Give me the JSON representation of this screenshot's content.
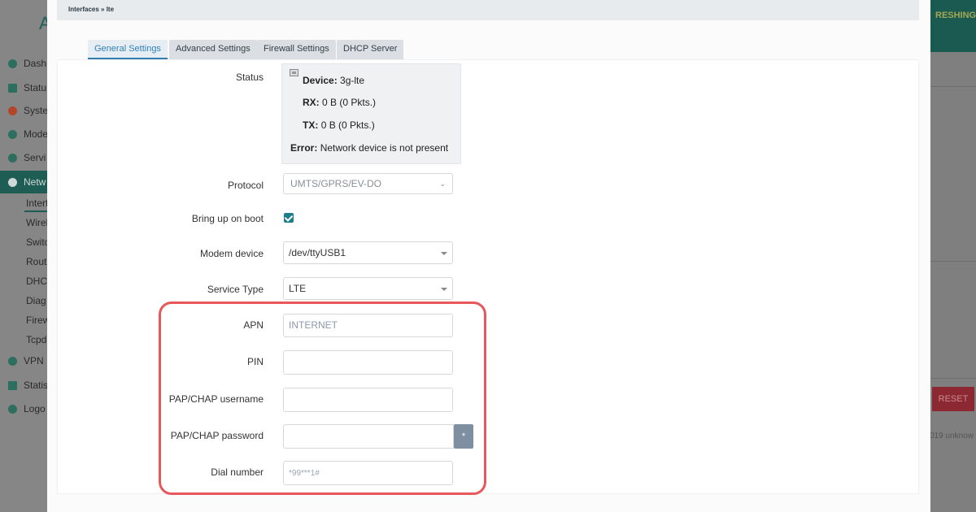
{
  "background": {
    "logo_letter": "A",
    "nav": [
      "Dash",
      "Statu",
      "Syste",
      "Mode",
      "Servi",
      "Netw",
      "VPN",
      "Statis",
      "Logo"
    ],
    "subnav": [
      "Interf",
      "Wirel",
      "Switc",
      "Rout",
      "DHC",
      "Diag",
      "Firew",
      "Tcpd"
    ],
    "refresh_label": "RESHING",
    "reset_label": "RESET",
    "copyright": "019 unknow"
  },
  "modal": {
    "breadcrumb": "Interfaces » lte",
    "tabs": [
      {
        "label": "General Settings",
        "active": true
      },
      {
        "label": "Advanced Settings",
        "active": false
      },
      {
        "label": "Firewall Settings",
        "active": false
      },
      {
        "label": "DHCP Server",
        "active": false
      }
    ]
  },
  "form": {
    "status_label": "Status",
    "status": {
      "device_key": "Device:",
      "device_val": "3g-lte",
      "rx_key": "RX:",
      "rx_val": "0 B (0 Pkts.)",
      "tx_key": "TX:",
      "tx_val": "0 B (0 Pkts.)",
      "error_key": "Error:",
      "error_val": "Network device is not present"
    },
    "protocol_label": "Protocol",
    "protocol_value": "UMTS/GPRS/EV-DO",
    "boot_label": "Bring up on boot",
    "boot_checked": true,
    "modem_label": "Modem device",
    "modem_value": "/dev/ttyUSB1",
    "service_label": "Service Type",
    "service_value": "LTE",
    "apn_label": "APN",
    "apn_placeholder": "INTERNET",
    "pin_label": "PIN",
    "pin_value": "",
    "user_label": "PAP/CHAP username",
    "user_value": "",
    "pass_label": "PAP/CHAP password",
    "pass_value": "",
    "pass_toggle": "*",
    "dial_label": "Dial number",
    "dial_placeholder": "*99***1#"
  },
  "colors": {
    "accent": "#2f7fb4",
    "highlight": "#e8585a",
    "checkbox": "#1e7f8c"
  }
}
